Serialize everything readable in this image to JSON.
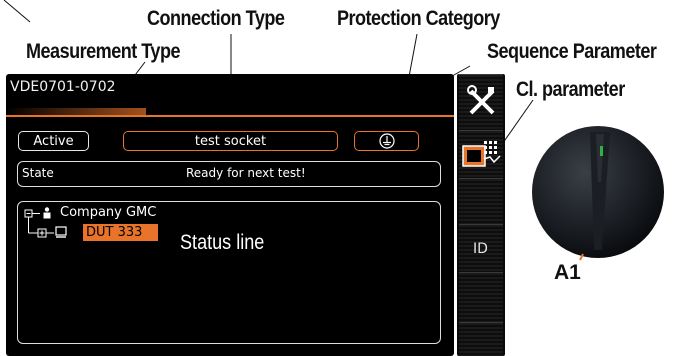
{
  "callouts": {
    "connection_type": "Connection Type",
    "protection_category": "Protection Category",
    "measurement_type": "Measurement Type",
    "sequence_parameter": "Sequence Parameter",
    "cl_parameter": "Cl. parameter",
    "status_line": "Status line",
    "knob": "A1"
  },
  "screen": {
    "title": "VDE0701-0702",
    "mode_button": "Active",
    "connection_button": "test socket",
    "state_label": "State",
    "state_value": "Ready for next test!",
    "tree": {
      "root_label": "Company GMC",
      "selected_item": "DUT 333"
    }
  },
  "sidebar": {
    "id_label": "ID"
  },
  "colors": {
    "accent": "#e8732a",
    "screen_bg": "#000000"
  },
  "icons": [
    "tools-icon",
    "parameter-grid-icon",
    "protection-ground-icon",
    "company-icon",
    "device-icon",
    "tree-expand-icon"
  ]
}
